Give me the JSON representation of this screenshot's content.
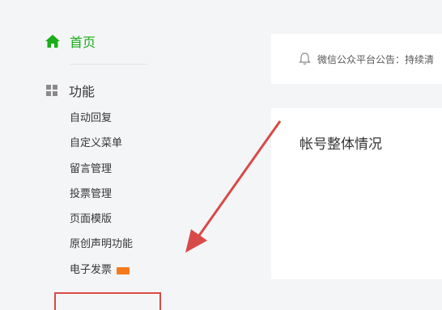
{
  "sidebar": {
    "home_label": "首页",
    "section_label": "功能",
    "items": [
      {
        "label": "自动回复"
      },
      {
        "label": "自定义菜单"
      },
      {
        "label": "留言管理"
      },
      {
        "label": "投票管理"
      },
      {
        "label": "页面模版"
      },
      {
        "label": "原创声明功能"
      },
      {
        "label": "电子发票",
        "badge": "new"
      }
    ]
  },
  "main": {
    "notice_text": "微信公众平台公告：持续清",
    "overview_title": "帐号整体情况"
  },
  "colors": {
    "brand_green": "#1aad19",
    "arrow_red": "#d84a47",
    "badge_orange": "#f37b1d"
  },
  "icons": [
    "home-icon",
    "grid-icon",
    "bell-icon",
    "new-badge-icon"
  ]
}
